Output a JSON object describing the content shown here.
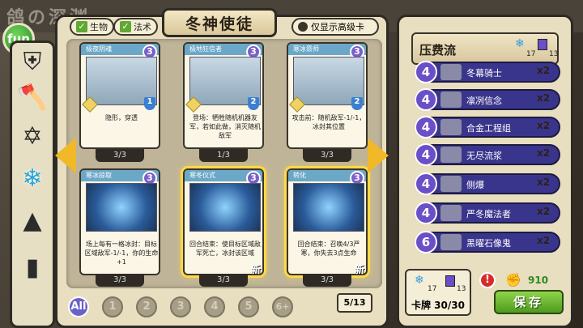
{
  "header": {
    "deco_title": "鸽の深渊",
    "logo": "fun"
  },
  "filters": {
    "creature": "生物",
    "spell": "法术",
    "title": "冬神使徒",
    "advanced_only": "仅显示高级卡"
  },
  "categories": [
    "shield-icon",
    "axe-icon",
    "star-of-david-icon",
    "snowflake-icon",
    "witch-hat-icon",
    "book-icon"
  ],
  "cards": [
    {
      "name": "极夜阴魂",
      "cost": "3",
      "hp": "1",
      "desc": "隐形，穿透",
      "count": "3/3",
      "new": ""
    },
    {
      "name": "极地狂信者",
      "cost": "3",
      "hp": "2",
      "desc": "登场：牺牲随机机器友军，若如此做，消灭随机敌军",
      "count": "1/3",
      "new": ""
    },
    {
      "name": "寒冰祭师",
      "cost": "3",
      "hp": "2",
      "desc": "攻击前：随机敌军-1/-1，冰封其位置",
      "count": "3/3",
      "new": ""
    },
    {
      "name": "寒冰掠取",
      "cost": "3",
      "hp": "",
      "desc": "场上每有一格冰封：目标区域敌军-1/-1，你的生命+1",
      "count": "3/3",
      "new": ""
    },
    {
      "name": "寒冬仪式",
      "cost": "3",
      "hp": "",
      "desc": "回合结束：使目标区域敌军死亡，冰封该区域",
      "count": "3/3",
      "new": "新"
    },
    {
      "name": "转化",
      "cost": "3",
      "hp": "",
      "desc": "回合结束：召唤4/3严寒，你失去3点生命",
      "count": "3/3",
      "new": "新"
    }
  ],
  "cost_filters": [
    "All",
    "1",
    "2",
    "3",
    "4",
    "5",
    "6+"
  ],
  "page": "5/13",
  "deck": {
    "title": "压费流",
    "snow_count": "17",
    "purple_count": "13",
    "rows": [
      {
        "cost": "4",
        "name": "冬幕骑士",
        "qty": "x2"
      },
      {
        "cost": "4",
        "name": "凛冽信念",
        "qty": "x2"
      },
      {
        "cost": "4",
        "name": "合金工程组",
        "qty": "x2"
      },
      {
        "cost": "4",
        "name": "无尽流浆",
        "qty": "x2"
      },
      {
        "cost": "4",
        "name": "侧爆",
        "qty": "x2"
      },
      {
        "cost": "4",
        "name": "严冬魔法者",
        "qty": "x2"
      },
      {
        "cost": "6",
        "name": "黑曜石像鬼",
        "qty": "x2"
      }
    ],
    "bottom_snow": "17",
    "bottom_purple": "13",
    "card_count": "卡牌 30/30",
    "gold": "910",
    "save": "保存",
    "warning": "!"
  }
}
